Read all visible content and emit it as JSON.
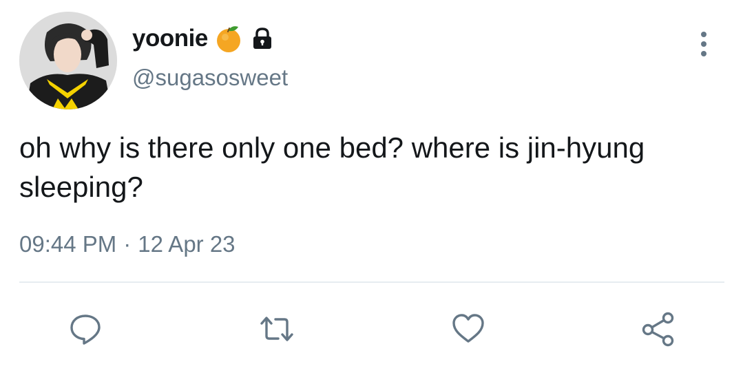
{
  "user": {
    "display_name": "yoonie",
    "handle": "@sugasosweet",
    "avatar_icon": "avatar-photo",
    "name_emoji": "tangerine-icon",
    "protected_icon": "lock-icon"
  },
  "tweet": {
    "text": "oh why is there only one bed? where is jin-hyung sleeping?",
    "time": "09:44 PM",
    "separator": "·",
    "date": "12 Apr 23"
  },
  "actions": [
    {
      "name": "reply",
      "icon": "reply-icon"
    },
    {
      "name": "retweet",
      "icon": "retweet-icon"
    },
    {
      "name": "like",
      "icon": "heart-icon"
    },
    {
      "name": "share",
      "icon": "share-icon"
    }
  ],
  "colors": {
    "text_primary": "#14171a",
    "text_secondary": "#657786",
    "icon": "#657786",
    "divider": "#e6ecf0",
    "background": "#ffffff"
  }
}
